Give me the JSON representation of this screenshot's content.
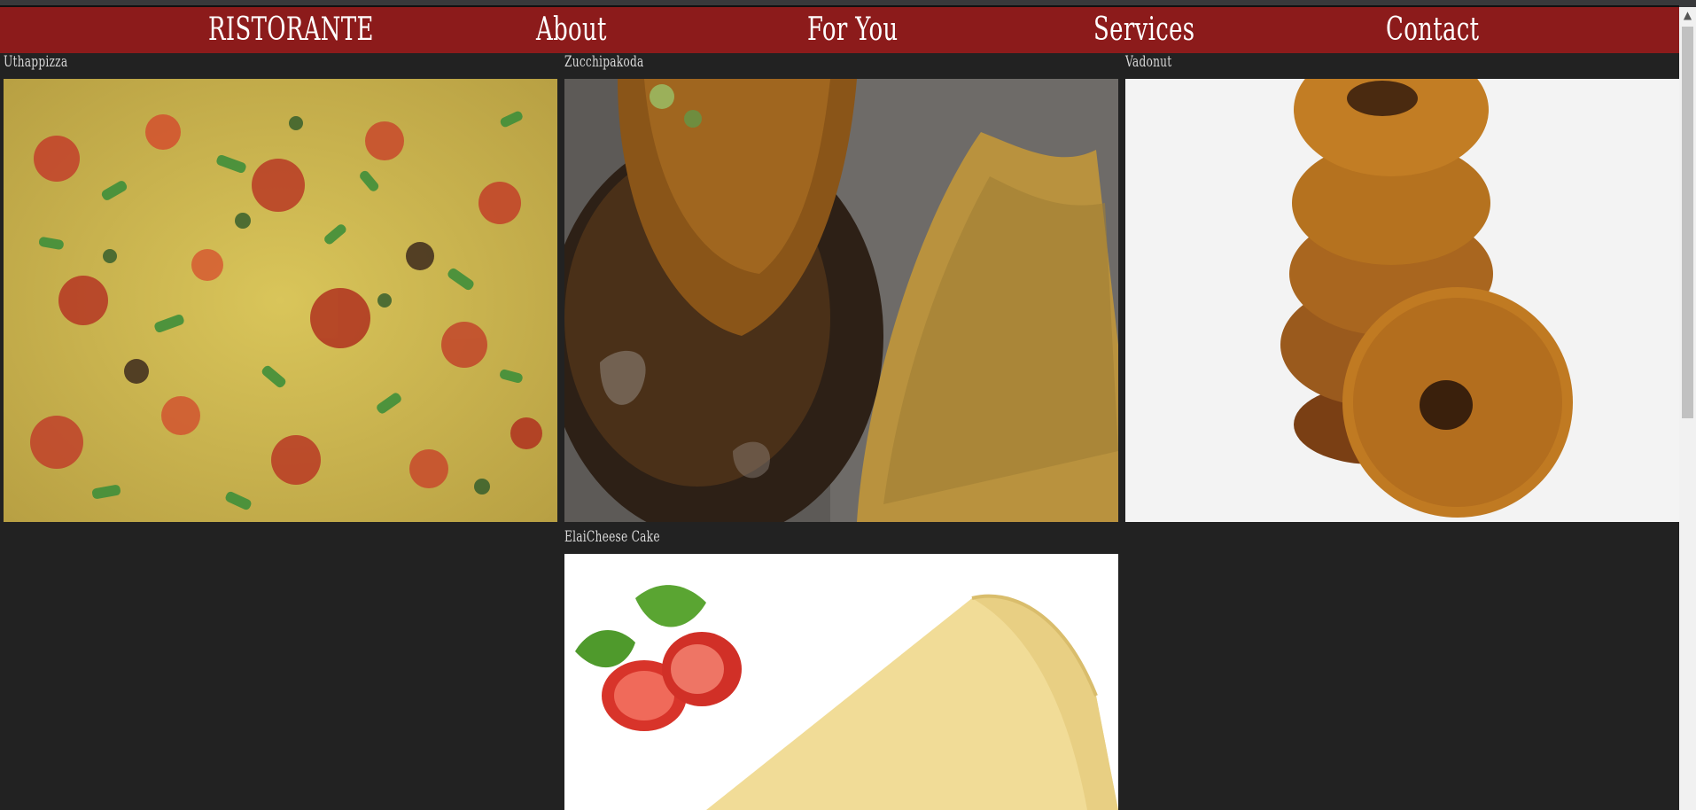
{
  "nav": {
    "brand": "RISTORANTE",
    "items": [
      "About",
      "For You",
      "Services",
      "Contact"
    ]
  },
  "menu": {
    "items": [
      {
        "title": "Uthappizza",
        "image": "pizza-photo"
      },
      {
        "title": "Zucchipakoda",
        "image": "pakoda-photo"
      },
      {
        "title": "Vadonut",
        "image": "donut-photo"
      },
      {
        "title": "ElaiCheese Cake",
        "image": "cheesecake-photo"
      }
    ]
  },
  "colors": {
    "navbar": "#8c1b1b",
    "background": "#222222",
    "nav_text": "#ffffff",
    "card_title": "#d8d8d8"
  }
}
